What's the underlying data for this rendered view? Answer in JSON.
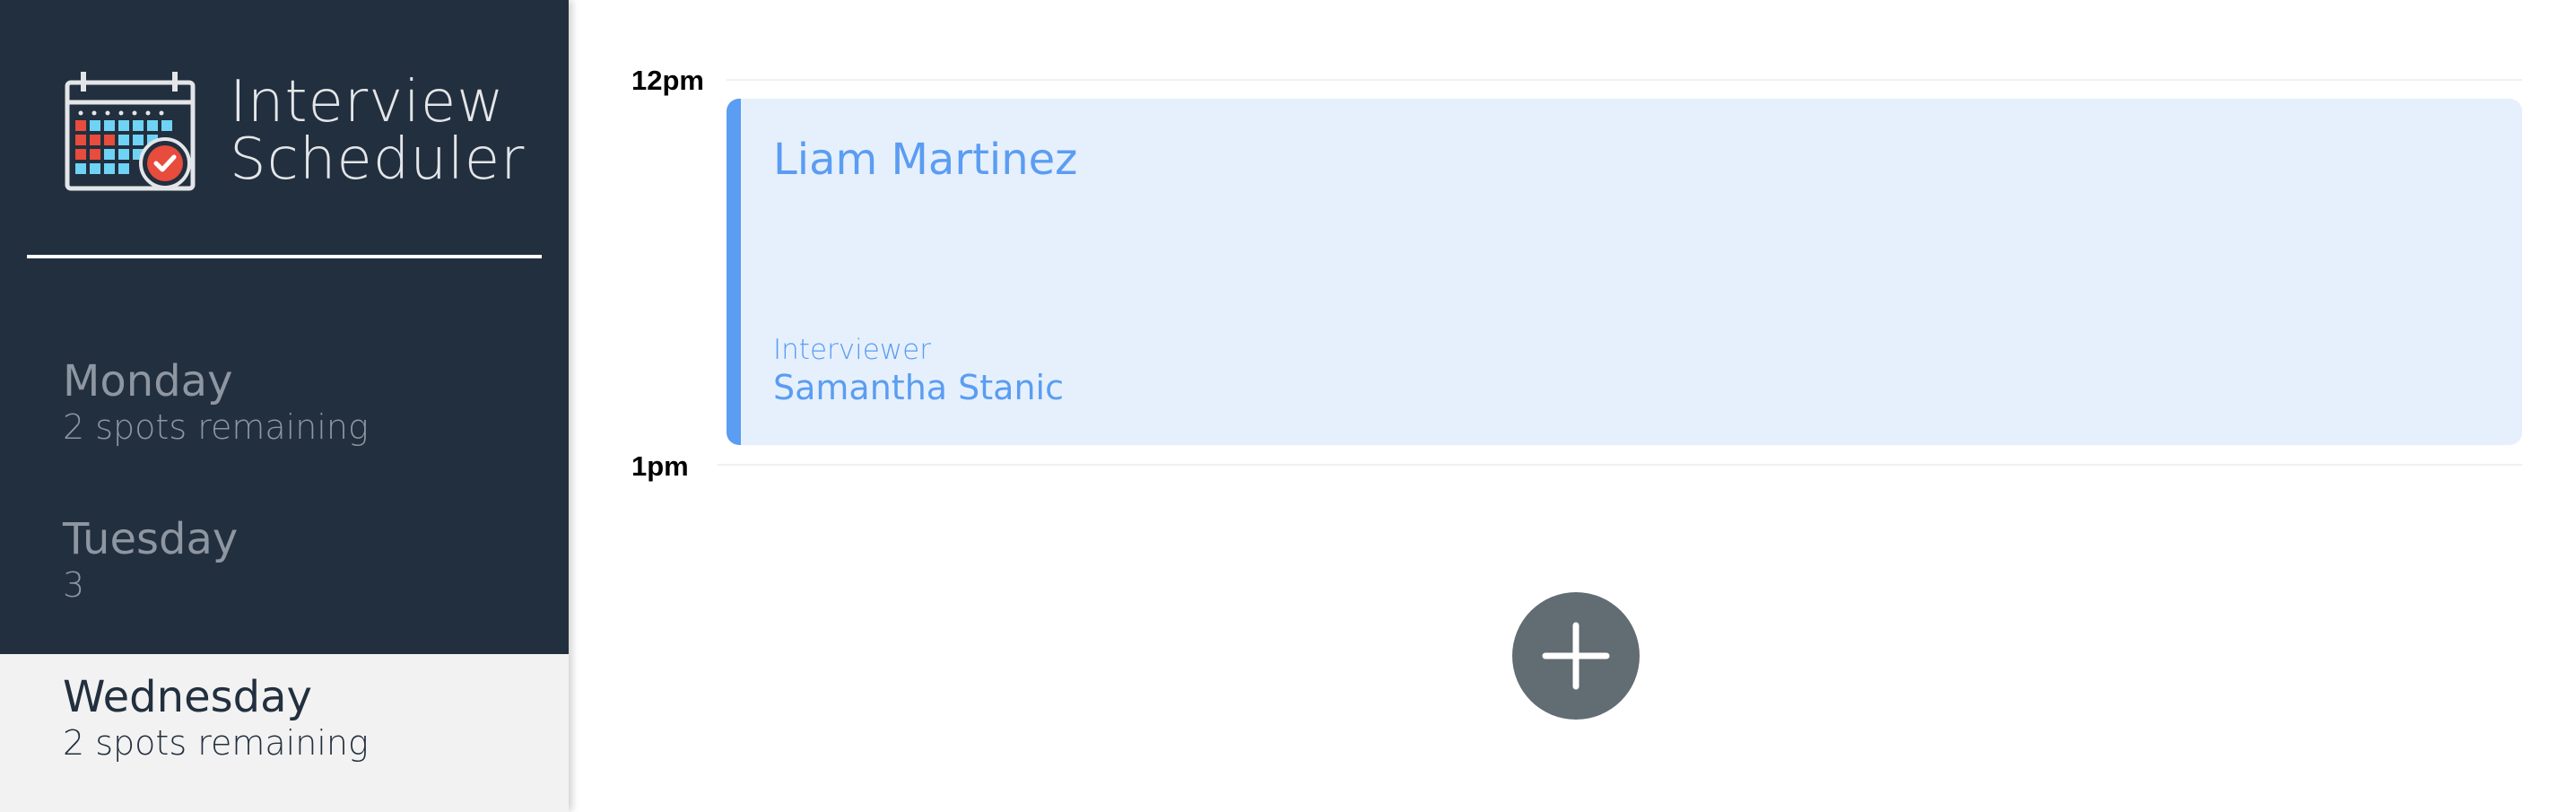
{
  "app": {
    "title_line1": "Interview",
    "title_line2": "Scheduler",
    "logo_icon": "calendar-check-icon"
  },
  "days": [
    {
      "name": "Monday",
      "spots": "2 spots remaining",
      "selected": false
    },
    {
      "name": "Tuesday",
      "spots": "3",
      "selected": false
    },
    {
      "name": "Wednesday",
      "spots": "2 spots remaining",
      "selected": true
    }
  ],
  "schedule": {
    "time_labels": [
      "12pm",
      "1pm"
    ],
    "appointment": {
      "student": "Liam Martinez",
      "interviewer_label": "Interviewer",
      "interviewer": "Samantha Stanic"
    },
    "add_button_icon": "plus-icon"
  },
  "colors": {
    "sidebar_bg": "#222f3e",
    "selected_day_bg": "#f2f2f2",
    "appointment_bg": "#e6f0fd",
    "accent": "#5a9df2",
    "add_button": "#626c73",
    "logo_red": "#e74c3c",
    "logo_cyan": "#6fd3f5"
  }
}
